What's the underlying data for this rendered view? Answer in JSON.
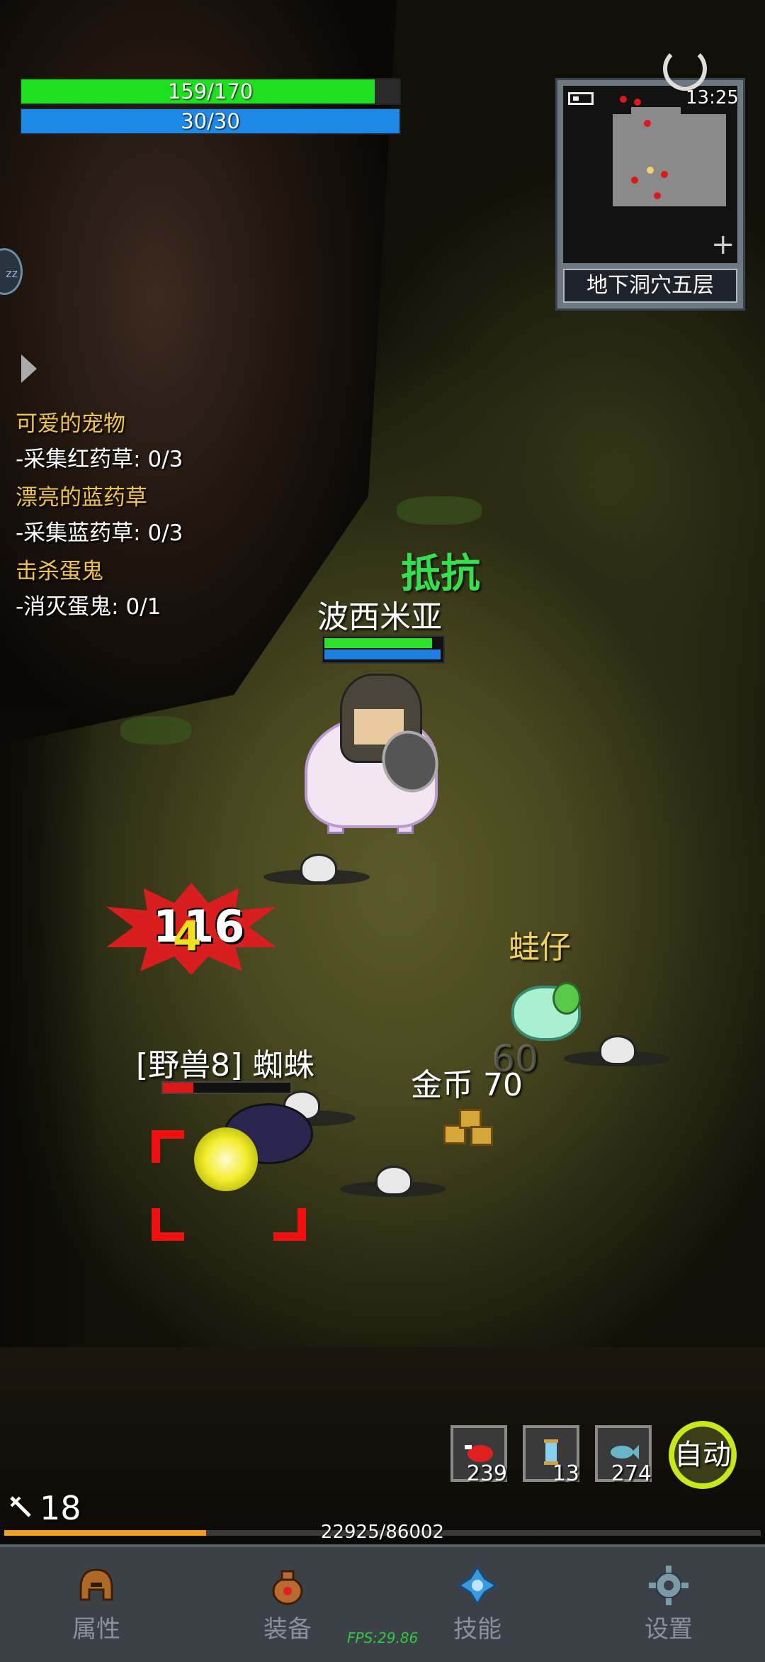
{
  "hud": {
    "hp": {
      "text": "159/170",
      "current": 159,
      "max": 170
    },
    "mp": {
      "text": "30/30",
      "current": 30,
      "max": 30
    }
  },
  "minimap": {
    "clock": "13:25",
    "location": "地下洞穴五层"
  },
  "quests": [
    {
      "title": "可爱的宠物",
      "task": "-采集红药草: 0/3"
    },
    {
      "title": "漂亮的蓝药草",
      "task": "-采集蓝药草: 0/3"
    },
    {
      "title": "击杀蛋鬼",
      "task": "-消灭蛋鬼: 0/1"
    }
  ],
  "world": {
    "resist_text": "抵抗",
    "player_name": "波西米亚",
    "damage_number": "116",
    "damage_small": "4",
    "pet_name": "蛙仔",
    "faded_number": "60",
    "enemy_name": "[野兽8] 蜘蛛",
    "enemy_hp_fraction": 0.24,
    "loot_text": "金币 70"
  },
  "quickbar": [
    {
      "icon": "red-meat-icon",
      "count": "239"
    },
    {
      "icon": "scroll-icon",
      "count": "13"
    },
    {
      "icon": "fish-icon",
      "count": "274"
    }
  ],
  "auto_label": "自动",
  "level": "18",
  "xp": {
    "text": "22925/86002",
    "current": 22925,
    "max": 86002
  },
  "nav": [
    {
      "label": "属性",
      "icon": "helmet-icon"
    },
    {
      "label": "装备",
      "icon": "bag-icon"
    },
    {
      "label": "技能",
      "icon": "skill-gem-icon"
    },
    {
      "label": "设置",
      "icon": "gear-icon"
    }
  ],
  "fps": "FPS:29.86",
  "colors": {
    "hp": "#1fe01f",
    "mp": "#1e88e6",
    "quest_title": "#f0c34a",
    "resist": "#35e04a",
    "xp": "#f0a020",
    "auto_ring": "#c9e81a"
  }
}
